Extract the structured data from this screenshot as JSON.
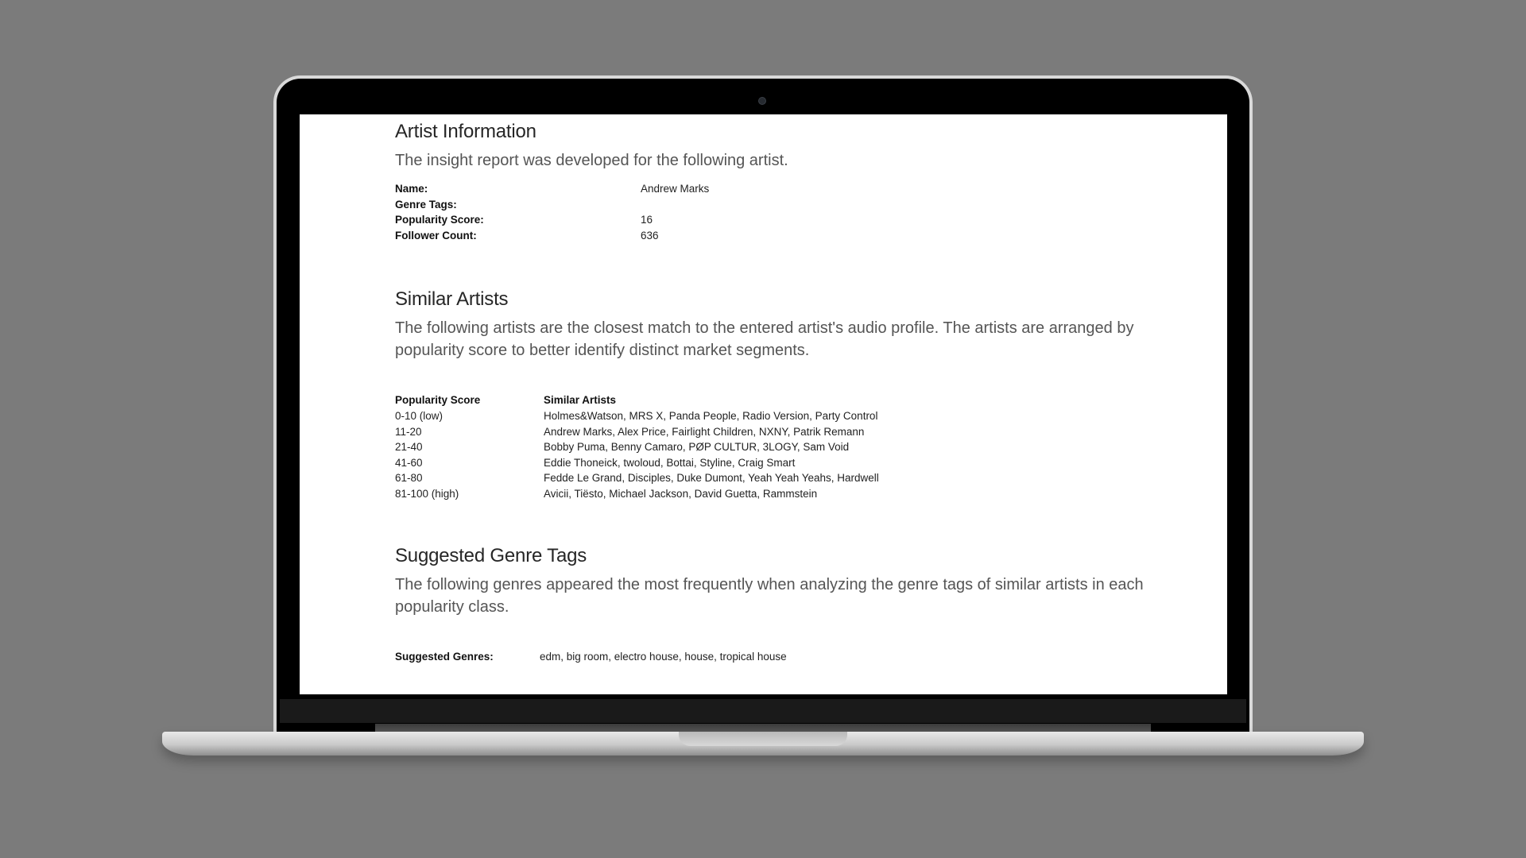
{
  "artist_info": {
    "title": "Artist Information",
    "lead": "The insight report was developed for the following artist.",
    "fields": [
      {
        "label": "Name:",
        "value": "Andrew Marks"
      },
      {
        "label": "Genre Tags:",
        "value": ""
      },
      {
        "label": "Popularity Score:",
        "value": "16"
      },
      {
        "label": "Follower Count:",
        "value": "636"
      }
    ]
  },
  "similar_artists": {
    "title": "Similar Artists",
    "lead": "The following artists are the closest match to the entered artist's audio profile. The artists are arranged by popularity score to better identify distinct market segments.",
    "columns": [
      "Popularity Score",
      "Similar Artists"
    ],
    "rows": [
      {
        "range": "0-10 (low)",
        "artists": "Holmes&Watson, MRS X, Panda People, Radio Version, Party Control"
      },
      {
        "range": "11-20",
        "artists": "Andrew Marks, Alex Price, Fairlight Children, NXNY, Patrik Remann"
      },
      {
        "range": "21-40",
        "artists": "Bobby Puma, Benny Camaro, PØP CULTUR, 3LOGY, Sam Void"
      },
      {
        "range": "41-60",
        "artists": "Eddie Thoneick, twoloud, Bottai, Styline, Craig Smart"
      },
      {
        "range": "61-80",
        "artists": "Fedde Le Grand, Disciples, Duke Dumont, Yeah Yeah Yeahs, Hardwell"
      },
      {
        "range": "81-100 (high)",
        "artists": "Avicii, Tiësto, Michael Jackson, David Guetta, Rammstein"
      }
    ]
  },
  "genre_tags": {
    "title": "Suggested Genre Tags",
    "lead": "The following genres appeared the most frequently when analyzing the genre tags of similar artists in each popularity class.",
    "label": "Suggested Genres:",
    "value": "edm, big room, electro house, house, tropical house"
  }
}
